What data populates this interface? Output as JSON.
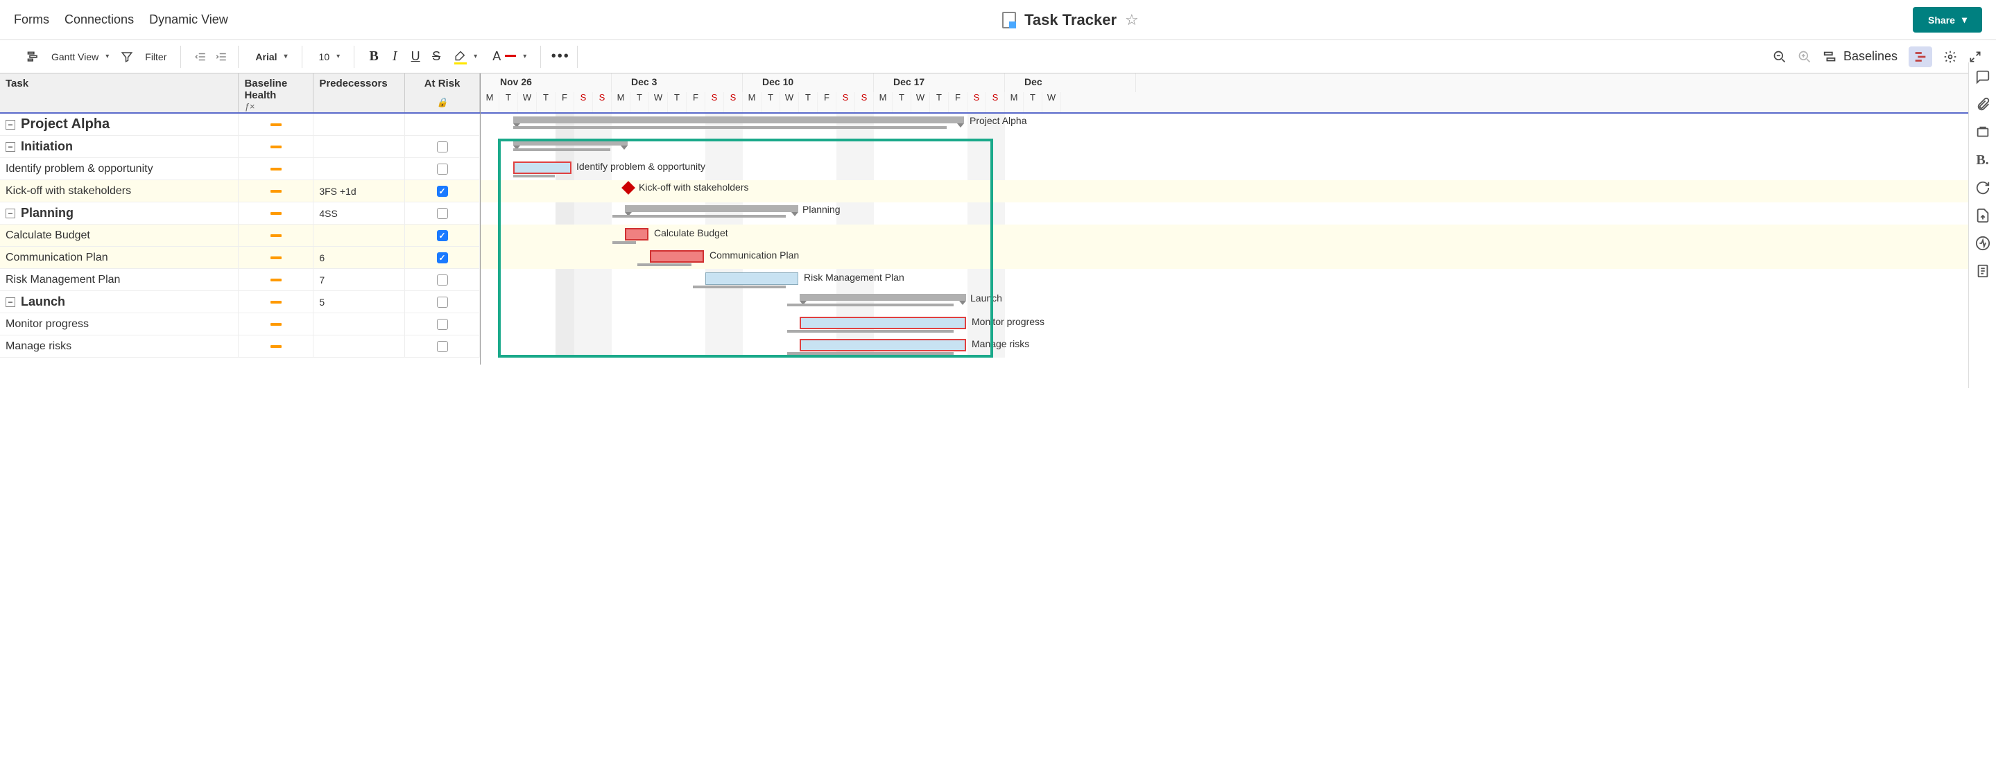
{
  "topnav": {
    "links": [
      "Forms",
      "Connections",
      "Dynamic View"
    ],
    "title": "Task Tracker",
    "share_label": "Share"
  },
  "toolbar": {
    "view_label": "Gantt View",
    "filter_label": "Filter",
    "font_name": "Arial",
    "font_size": "10",
    "baselines_label": "Baselines"
  },
  "grid": {
    "headers": {
      "task": "Task",
      "baseline_health": "Baseline Health",
      "predecessors": "Predecessors",
      "at_risk": "At Risk"
    },
    "rows": [
      {
        "level": 0,
        "name": "Project Alpha",
        "pred": "",
        "risk": null,
        "yellow": false
      },
      {
        "level": 1,
        "name": "Initiation",
        "pred": "",
        "risk": false,
        "yellow": false
      },
      {
        "level": 2,
        "name": "Identify problem & opportunity",
        "pred": "",
        "risk": false,
        "yellow": false
      },
      {
        "level": 2,
        "name": "Kick-off with stakeholders",
        "pred": "3FS +1d",
        "risk": true,
        "yellow": true
      },
      {
        "level": 1,
        "name": "Planning",
        "pred": "4SS",
        "risk": false,
        "yellow": false
      },
      {
        "level": 2,
        "name": "Calculate Budget",
        "pred": "",
        "risk": true,
        "yellow": true
      },
      {
        "level": 2,
        "name": "Communication Plan",
        "pred": "6",
        "risk": true,
        "yellow": true
      },
      {
        "level": 2,
        "name": "Risk Management Plan",
        "pred": "7",
        "risk": false,
        "yellow": false
      },
      {
        "level": 1,
        "name": "Launch",
        "pred": "5",
        "risk": false,
        "yellow": false
      },
      {
        "level": 2,
        "name": "Monitor progress",
        "pred": "",
        "risk": false,
        "yellow": false
      },
      {
        "level": 2,
        "name": "Manage risks",
        "pred": "",
        "risk": false,
        "yellow": false
      }
    ]
  },
  "timeline": {
    "weeks": [
      "Nov 26",
      "Dec 3",
      "Dec 10",
      "Dec 17",
      "Dec"
    ],
    "days": [
      "M",
      "T",
      "W",
      "T",
      "F",
      "S",
      "S",
      "M",
      "T",
      "W",
      "T",
      "F",
      "S",
      "S",
      "M",
      "T",
      "W",
      "T",
      "F",
      "S",
      "S",
      "M",
      "T",
      "W",
      "T",
      "F",
      "S",
      "S",
      "M",
      "T",
      "W"
    ]
  },
  "gantt_labels": {
    "r0": "Project Alpha",
    "r2": "Identify problem & opportunity",
    "r3": "Kick-off with stakeholders",
    "r4": "Planning",
    "r5": "Calculate Budget",
    "r6": "Communication Plan",
    "r7": "Risk Management Plan",
    "r8": "Launch",
    "r9": "Monitor progress",
    "r10": "Manage risks"
  },
  "chart_data": {
    "type": "gantt",
    "unit": "day",
    "day0": "2018-11-26",
    "tasks": [
      {
        "id": 1,
        "name": "Project Alpha",
        "type": "summary",
        "start": 1,
        "end": 24
      },
      {
        "id": 2,
        "name": "Initiation",
        "type": "summary",
        "start": 1,
        "end": 7
      },
      {
        "id": 3,
        "name": "Identify problem & opportunity",
        "type": "task",
        "start": 1,
        "end": 4,
        "status": "blue-late",
        "baseline_start": 1,
        "baseline_end": 3
      },
      {
        "id": 4,
        "name": "Kick-off with stakeholders",
        "type": "milestone",
        "start": 7,
        "predecessors": "3FS +1d"
      },
      {
        "id": 5,
        "name": "Planning",
        "type": "summary",
        "start": 7,
        "end": 17,
        "predecessors": "4SS"
      },
      {
        "id": 6,
        "name": "Calculate Budget",
        "type": "task",
        "start": 7,
        "end": 8,
        "status": "red",
        "baseline_start": 7,
        "baseline_end": 8
      },
      {
        "id": 7,
        "name": "Communication Plan",
        "type": "task",
        "start": 9,
        "end": 12,
        "status": "red",
        "predecessors": "6",
        "baseline_start": 8,
        "baseline_end": 11
      },
      {
        "id": 8,
        "name": "Risk Management Plan",
        "type": "task",
        "start": 12,
        "end": 17,
        "status": "blue",
        "predecessors": "7",
        "baseline_start": 11,
        "baseline_end": 16
      },
      {
        "id": 9,
        "name": "Launch",
        "type": "summary",
        "start": 17,
        "end": 25,
        "predecessors": "5"
      },
      {
        "id": 10,
        "name": "Monitor progress",
        "type": "task",
        "start": 17,
        "end": 25,
        "status": "blue-late",
        "baseline_start": 16,
        "baseline_end": 24
      },
      {
        "id": 11,
        "name": "Manage risks",
        "type": "task",
        "start": 17,
        "end": 25,
        "status": "blue-late",
        "baseline_start": 16,
        "baseline_end": 24
      }
    ]
  }
}
